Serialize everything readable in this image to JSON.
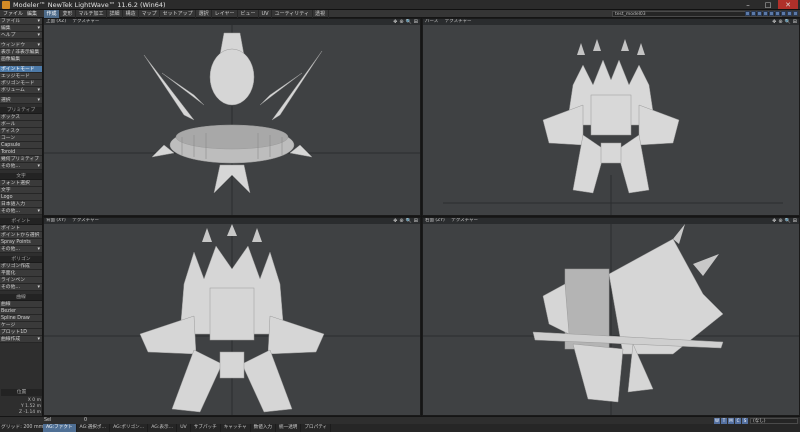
{
  "window": {
    "title": "Modeler™ NewTek LightWave™ 11.6.2 (Win64)",
    "minimize": "–",
    "maximize": "□",
    "close": "✕",
    "app_icon": "lightwave-logo-icon"
  },
  "menubar": {
    "left_items": [
      "ファイル",
      "編集"
    ],
    "tabs": [
      "作成",
      "変形",
      "マルチ加工",
      "詳細",
      "構造",
      "マップ",
      "セットアップ",
      "選択",
      "レイヤー",
      "ビュー",
      "UV",
      "ユーティリティ",
      "透視"
    ],
    "active_tab": 0,
    "layer_dropdown": "test_model03",
    "layer_count": 9
  },
  "sidebar": {
    "groups": [
      {
        "items": [
          {
            "label": "ファイル",
            "dd": true
          },
          {
            "label": "編集",
            "dd": true
          },
          {
            "label": "ヘルプ",
            "dd": true
          }
        ]
      },
      {
        "items": [
          {
            "label": "ウィンドウ",
            "dd": true
          },
          {
            "label": "表示 / 非表示編集"
          },
          {
            "label": "画像編集"
          }
        ]
      },
      {
        "items": [
          {
            "label": "ポイントモード",
            "sel": true
          },
          {
            "label": "エッジモード"
          },
          {
            "label": "ポリゴンモード"
          },
          {
            "label": "ボリューム",
            "dd": true
          }
        ]
      },
      {
        "items": [
          {
            "label": "選択",
            "dd": true
          }
        ]
      },
      {
        "head": "プリミティブ",
        "items": [
          {
            "label": "ボックス"
          },
          {
            "label": "ボール"
          },
          {
            "label": "ディスク"
          },
          {
            "label": "コーン"
          },
          {
            "label": "Capsule"
          },
          {
            "label": "Toroid"
          },
          {
            "label": "幾何プリミティブ"
          },
          {
            "label": "その他…",
            "dd": true
          }
        ]
      },
      {
        "head": "文字",
        "items": [
          {
            "label": "フォント選択"
          },
          {
            "label": "文字"
          },
          {
            "label": "Logo"
          },
          {
            "label": "日本語入力"
          },
          {
            "label": "その他…",
            "dd": true
          }
        ]
      },
      {
        "head": "ポイント",
        "items": [
          {
            "label": "ポイント"
          },
          {
            "label": "ポイントから選択"
          },
          {
            "label": "Spray Points"
          },
          {
            "label": "その他…",
            "dd": true
          }
        ]
      },
      {
        "head": "ポリゴン",
        "items": [
          {
            "label": "ポリゴン作成"
          },
          {
            "label": "平面化"
          },
          {
            "label": "ラインペン"
          },
          {
            "label": "その他…",
            "dd": true
          }
        ]
      },
      {
        "head": "曲線",
        "items": [
          {
            "label": "曲線"
          },
          {
            "label": "Bezier"
          },
          {
            "label": "Spline Draw"
          },
          {
            "label": "ケージ"
          },
          {
            "label": "プロット1D"
          },
          {
            "label": "曲線作成",
            "dd": true
          }
        ]
      }
    ],
    "readout_head": "位置",
    "readout": [
      "X  0 m",
      "Y  1.52 m",
      "Z  -1.14 m"
    ]
  },
  "viewports": [
    {
      "name": "top",
      "view": "上面 (XZ)",
      "shading": "テクスチャー"
    },
    {
      "name": "perspective",
      "view": "パース",
      "shading": "テクスチャー"
    },
    {
      "name": "front",
      "view": "背面 (XY)",
      "shading": "テクスチャー"
    },
    {
      "name": "right",
      "view": "右面 (ZY)",
      "shading": "テクスチャー"
    }
  ],
  "viewport_controls": [
    "✥",
    "⊕",
    "🔍",
    "⊞"
  ],
  "statusbar": {
    "sel_label": "Sel",
    "sel_value": "0",
    "buttons": [
      "W",
      "T",
      "M",
      "C",
      "S"
    ],
    "dropdown": "(なし)"
  },
  "bottombar": {
    "grid": "グリッド: 200 mm",
    "items": [
      {
        "label": "AG:ファクト",
        "hl": true
      },
      {
        "label": "AG:選択ポ…"
      },
      {
        "label": "AG:ポリゴン…"
      },
      {
        "label": "AG:表示…"
      },
      {
        "label": "UV"
      },
      {
        "label": "サブパッチ"
      },
      {
        "label": "キャッチャ"
      },
      {
        "label": "数値入力"
      },
      {
        "label": "統一透明"
      },
      {
        "label": "プロパティ"
      }
    ]
  },
  "colors": {
    "accent": "#4d7aa8",
    "viewport_bg": "#3f4143",
    "model": "#d8d8d8"
  }
}
